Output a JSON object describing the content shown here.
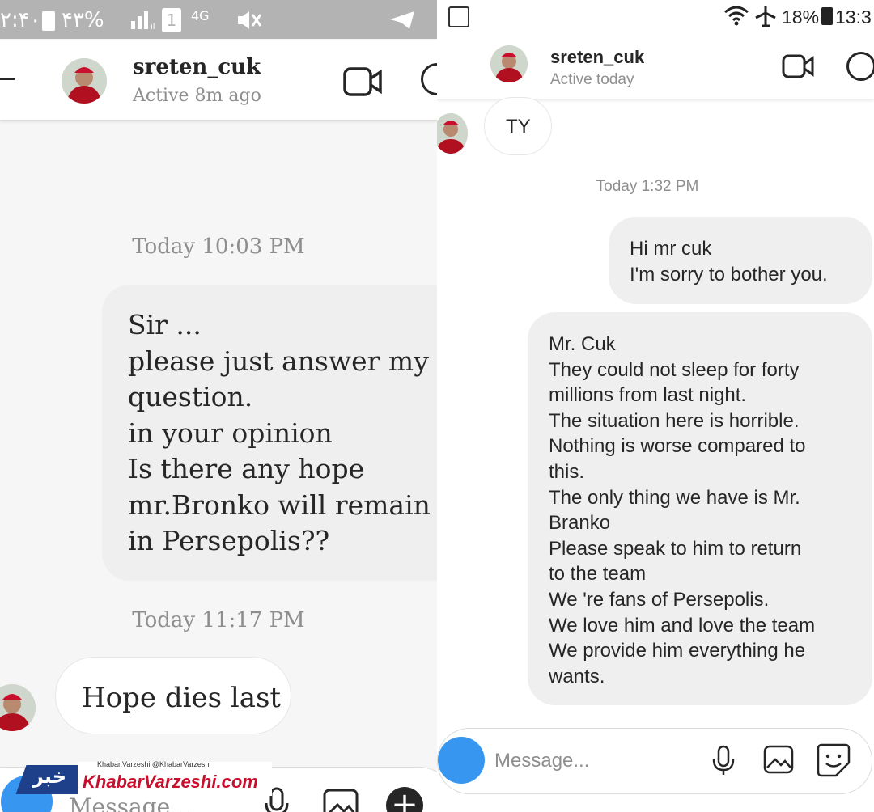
{
  "left": {
    "status": {
      "time": "۲:۴۰",
      "battery": "۴۳%",
      "network": "4G"
    },
    "header": {
      "username": "sreten_cuk",
      "active": "Active 8m ago"
    },
    "thread": {
      "timestamp1": "Today 10:03 PM",
      "sent_message": "Sir ...\nplease just answer my question.\nin your opinion\nIs there any hope\nmr.Bronko will remain\nin Persepolis??",
      "timestamp2": "Today 11:17 PM",
      "received_message": "Hope dies last"
    },
    "composer": {
      "placeholder": "Message..."
    }
  },
  "right": {
    "status": {
      "battery": "18%",
      "time": "13:3"
    },
    "header": {
      "username": "sreten_cuk",
      "active": "Active today"
    },
    "thread": {
      "received_message": "TY",
      "timestamp": "Today 1:32 PM",
      "sent_message_1": "Hi mr cuk\nI'm sorry to bother you.",
      "sent_message_2": "Mr. Cuk\nThey could not sleep for forty\nmillions from last night.\nThe situation here is horrible.\nNothing is worse compared to\nthis.\nThe only thing we have is Mr.\nBranko\nPlease speak to him to return\nto the team\nWe 're fans of Persepolis.\nWe love him and love the team\nWe provide him everything he\nwants."
    },
    "composer": {
      "placeholder": "Message..."
    }
  },
  "watermark": {
    "logo_text": "KhabarVarzeshi.com",
    "social": "Khabar.Varzeshi  @KhabarVarzeshi",
    "arabic": "خبر"
  }
}
